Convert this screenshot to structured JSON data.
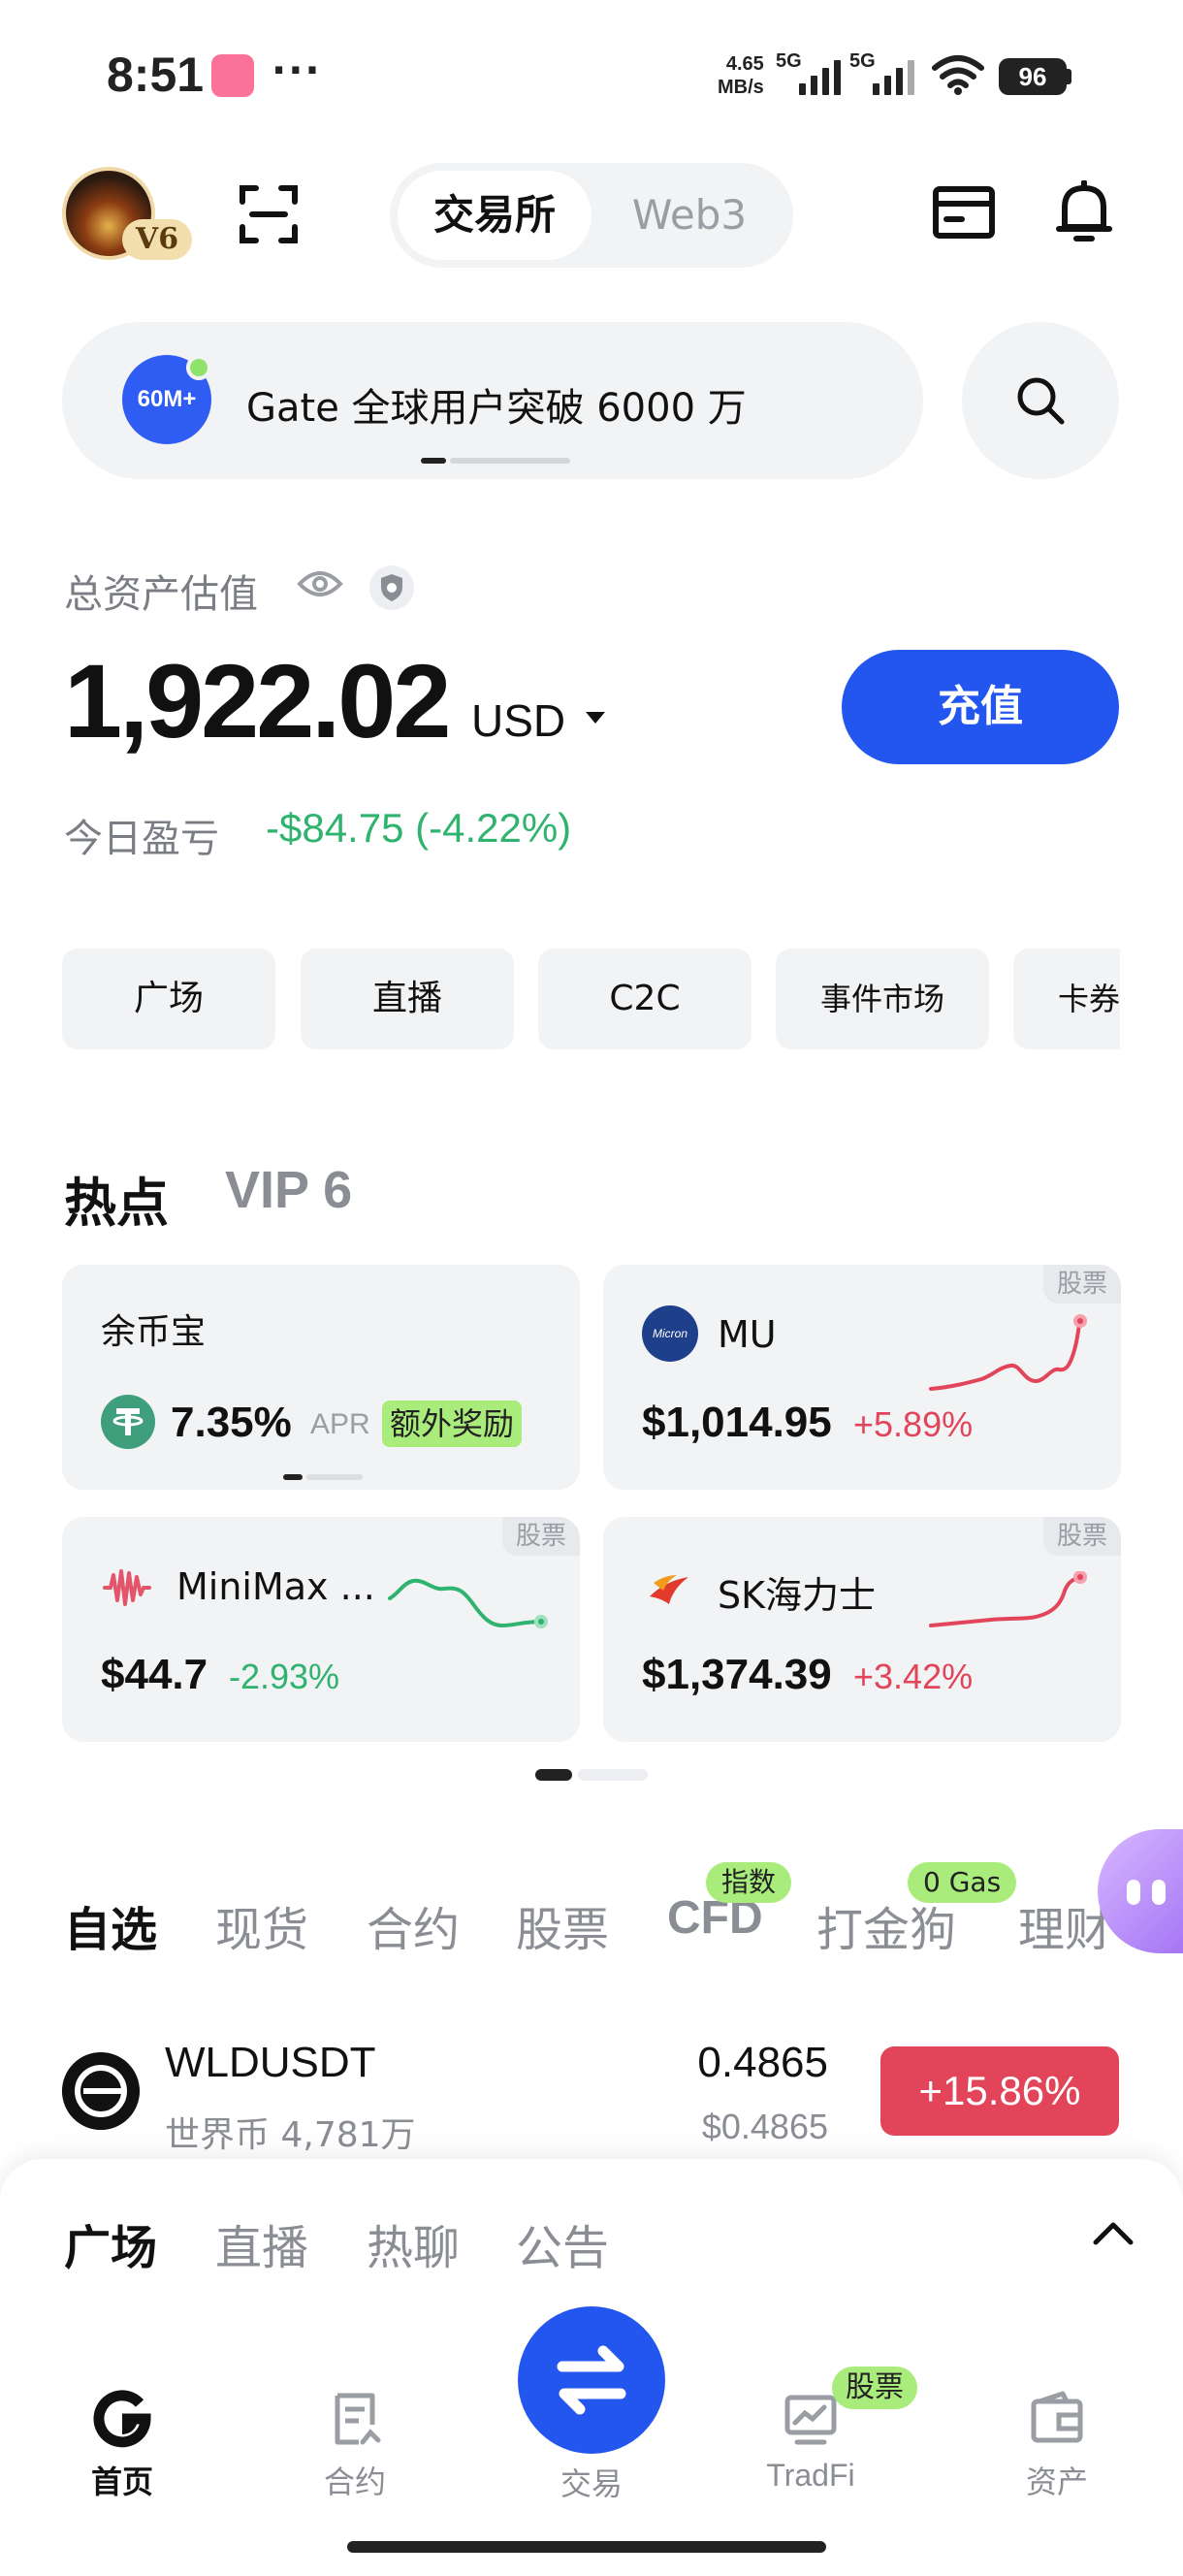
{
  "status_bar": {
    "time": "8:51",
    "dots": "···",
    "net_speed_value": "4.65",
    "net_speed_unit": "MB/s",
    "sig1": "5G",
    "sig2": "5G",
    "battery": "96"
  },
  "header": {
    "vip_level": "V6",
    "seg_active": "交易所",
    "seg_inactive": "Web3"
  },
  "announcement": {
    "logo_text": "60M+",
    "text": "Gate 全球用户突破 6000 万"
  },
  "assets": {
    "label": "总资产估值",
    "balance": "1,922.02",
    "currency": "USD",
    "deposit_label": "充值",
    "pnl_label": "今日盈亏",
    "pnl_value": "-$84.75 (-4.22%)"
  },
  "shortcuts": [
    "广场",
    "直播",
    "C2C",
    "事件市场",
    "卡券"
  ],
  "hot": {
    "title": "热点",
    "vip": "VIP 6",
    "cards": [
      {
        "name": "余币宝",
        "rate": "7.35%",
        "apr": "APR",
        "badge": "额外奖励"
      },
      {
        "name": "MU",
        "logo_text": "Micron",
        "tag": "股票",
        "price": "$1,014.95",
        "change": "+5.89%"
      },
      {
        "name": "MiniMax ...",
        "tag": "股票",
        "price": "$44.7",
        "change": "-2.93%"
      },
      {
        "name": "SK海力士",
        "tag": "股票",
        "price": "$1,374.39",
        "change": "+3.42%"
      }
    ]
  },
  "market_tabs": {
    "tabs": [
      "自选",
      "现货",
      "合约",
      "股票",
      "CFD",
      "打金狗",
      "理财"
    ],
    "cfd_badge": "指数",
    "dog_badge": "0 Gas"
  },
  "market_row": {
    "pair": "WLDUSDT",
    "name": "世界币",
    "volume": "4,781万",
    "price": "0.4865",
    "usd_price": "$0.4865",
    "change": "+15.86%"
  },
  "sheet_tabs": [
    "广场",
    "直播",
    "热聊",
    "公告"
  ],
  "nav": {
    "home": "首页",
    "futures": "合约",
    "trade": "交易",
    "tradfi": "TradFi",
    "tradfi_badge": "股票",
    "assets": "资产"
  },
  "colors": {
    "accent": "#2356ee",
    "up": "#e2455a",
    "down": "#2fb36e",
    "badge_green": "#a9ec7c"
  }
}
